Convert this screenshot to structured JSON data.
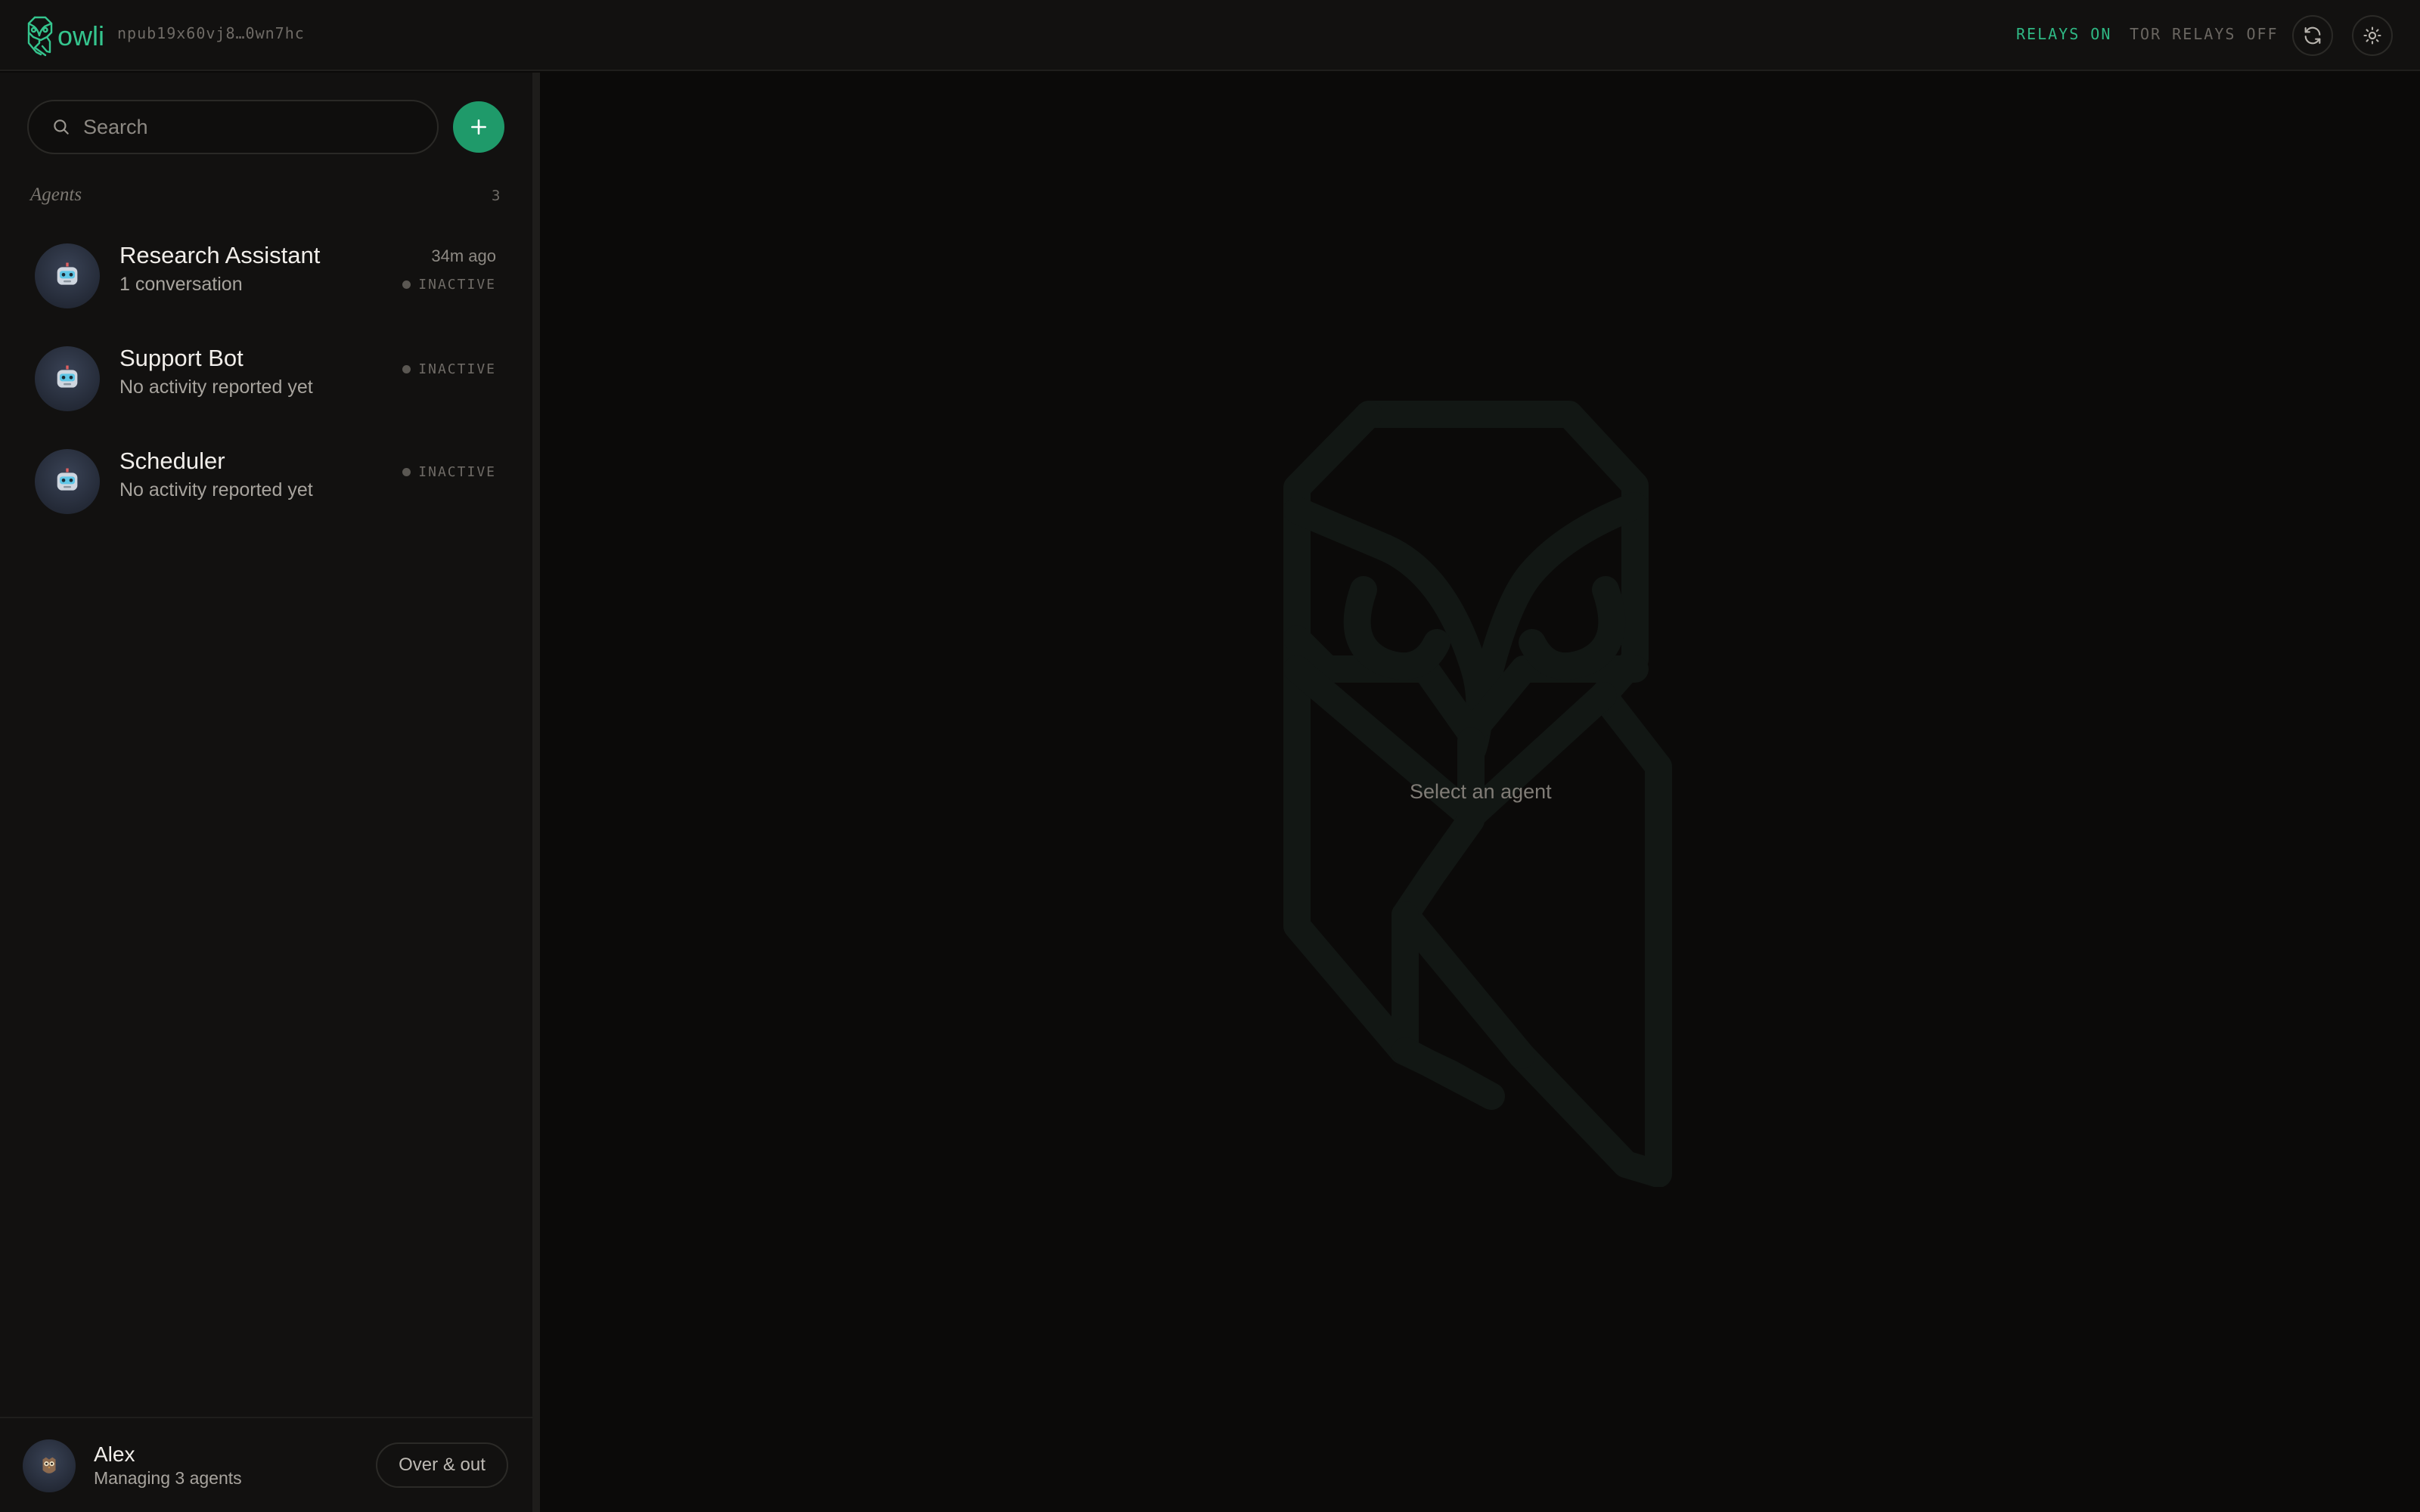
{
  "app": {
    "logo_text": "owli",
    "npub": "npub19x60vj8…0wn7hc",
    "accent": "#35c58e"
  },
  "header": {
    "relays_status": "RELAYS ON",
    "tor_status": "TOR RELAYS OFF",
    "refresh_icon": "refresh-icon",
    "theme_icon": "sun-icon"
  },
  "sidebar": {
    "search": {
      "placeholder": "Search",
      "value": ""
    },
    "add_icon": "plus-icon",
    "section_title": "Agents",
    "agent_count": "3",
    "agents": [
      {
        "name": "Research Assistant",
        "subtitle": "1 conversation",
        "time": "34m ago",
        "status": "INACTIVE",
        "avatar_icon": "robot-icon"
      },
      {
        "name": "Support Bot",
        "subtitle": "No activity reported yet",
        "time": "",
        "status": "INACTIVE",
        "avatar_icon": "robot-icon"
      },
      {
        "name": "Scheduler",
        "subtitle": "No activity reported yet",
        "time": "",
        "status": "INACTIVE",
        "avatar_icon": "robot-icon"
      }
    ]
  },
  "user": {
    "name": "Alex",
    "subtitle": "Managing 3 agents",
    "logout_label": "Over & out",
    "avatar_icon": "owl-avatar-icon"
  },
  "main": {
    "empty_text": "Select an agent",
    "watermark_icon": "owl-logo-icon"
  }
}
